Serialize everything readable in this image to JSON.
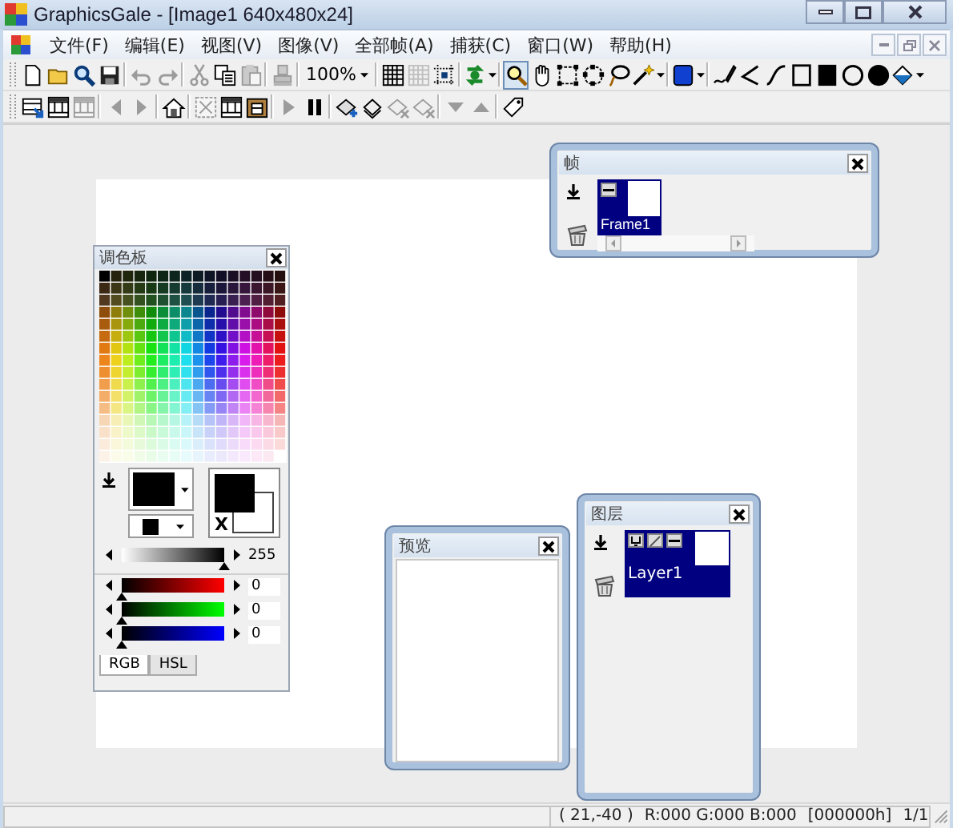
{
  "window": {
    "title": "GraphicsGale - [Image1 640x480x24]"
  },
  "menu": [
    "文件(F)",
    "编辑(E)",
    "视图(V)",
    "图像(V)",
    "全部帧(A)",
    "捕获(C)",
    "窗口(W)",
    "帮助(H)"
  ],
  "toolbars": [
    {
      "items": [
        {
          "kind": "button",
          "disabled": false,
          "pressed": false
        },
        {
          "kind": "button",
          "disabled": false,
          "pressed": false
        },
        {
          "kind": "button",
          "disabled": false,
          "pressed": false
        },
        {
          "kind": "button",
          "disabled": false,
          "pressed": false
        },
        {
          "kind": "button",
          "disabled": true,
          "pressed": false
        },
        {
          "kind": "button",
          "disabled": true,
          "pressed": false
        },
        {
          "kind": "button",
          "disabled": true,
          "pressed": false
        },
        {
          "kind": "button",
          "disabled": false,
          "pressed": false
        },
        {
          "kind": "button",
          "disabled": true,
          "pressed": false
        },
        {
          "kind": "button",
          "disabled": true,
          "pressed": false
        },
        {
          "kind": "combo",
          "value": "100%"
        },
        {
          "kind": "button",
          "disabled": false,
          "pressed": false
        },
        {
          "kind": "button",
          "disabled": true,
          "pressed": false
        },
        {
          "kind": "button",
          "disabled": false,
          "pressed": false
        },
        {
          "kind": "menu_button",
          "disabled": false,
          "pressed": false
        },
        {
          "kind": "button",
          "disabled": false,
          "pressed": true
        },
        {
          "kind": "button",
          "disabled": false,
          "pressed": false
        },
        {
          "kind": "button",
          "disabled": false,
          "pressed": false
        },
        {
          "kind": "button",
          "disabled": false,
          "pressed": false
        },
        {
          "kind": "button",
          "disabled": false,
          "pressed": false
        },
        {
          "kind": "menu_button",
          "disabled": false,
          "pressed": false
        },
        {
          "kind": "menu_button",
          "disabled": false,
          "pressed": false
        },
        {
          "kind": "button",
          "disabled": false,
          "pressed": false
        },
        {
          "kind": "button",
          "disabled": false,
          "pressed": false
        },
        {
          "kind": "button",
          "disabled": false,
          "pressed": false
        },
        {
          "kind": "button",
          "disabled": false,
          "pressed": false
        },
        {
          "kind": "button",
          "disabled": false,
          "pressed": false
        },
        {
          "kind": "button",
          "disabled": false,
          "pressed": false
        },
        {
          "kind": "button",
          "disabled": false,
          "pressed": false
        },
        {
          "kind": "menu_button",
          "disabled": false,
          "pressed": false
        }
      ]
    },
    {
      "items": [
        {
          "kind": "button",
          "disabled": false,
          "pressed": false
        },
        {
          "kind": "button",
          "disabled": false,
          "pressed": false
        },
        {
          "kind": "button",
          "disabled": true,
          "pressed": false
        },
        {
          "kind": "button",
          "disabled": true,
          "pressed": false
        },
        {
          "kind": "button",
          "disabled": true,
          "pressed": false
        },
        {
          "kind": "button",
          "disabled": false,
          "pressed": false
        },
        {
          "kind": "button",
          "disabled": true,
          "pressed": false
        },
        {
          "kind": "button",
          "disabled": false,
          "pressed": false
        },
        {
          "kind": "button",
          "disabled": false,
          "pressed": false
        },
        {
          "kind": "button",
          "disabled": true,
          "pressed": false
        },
        {
          "kind": "button",
          "disabled": false,
          "pressed": false
        },
        {
          "kind": "button",
          "disabled": false,
          "pressed": false
        },
        {
          "kind": "button",
          "disabled": false,
          "pressed": false
        },
        {
          "kind": "button",
          "disabled": true,
          "pressed": false
        },
        {
          "kind": "button",
          "disabled": true,
          "pressed": false
        },
        {
          "kind": "button",
          "disabled": true,
          "pressed": false
        },
        {
          "kind": "button",
          "disabled": true,
          "pressed": false
        },
        {
          "kind": "button",
          "disabled": false,
          "pressed": false
        }
      ]
    }
  ],
  "palette": {
    "title": "调色板",
    "swap_label": "X",
    "sliders": [
      {
        "kind": "value",
        "level": 1,
        "reading": "255"
      },
      {
        "kind": "red",
        "level": 0,
        "reading": "0"
      },
      {
        "kind": "green",
        "level": 0,
        "reading": "0"
      },
      {
        "kind": "blue",
        "level": 0,
        "reading": "0"
      }
    ],
    "tabs": [
      {
        "label": "RGB",
        "selected": true
      },
      {
        "label": "HSL",
        "selected": false
      }
    ]
  },
  "frames": {
    "title": "帧",
    "items": [
      {
        "label": "Frame1",
        "selected": true
      }
    ]
  },
  "preview": {
    "title": "预览"
  },
  "layers": {
    "title": "图层",
    "items": [
      {
        "label": "Layer1",
        "selected": true
      }
    ]
  },
  "status_bar": [
    "( 21,-40 )",
    "R:000 G:000 B:000",
    "[000000h]",
    "1/1"
  ]
}
